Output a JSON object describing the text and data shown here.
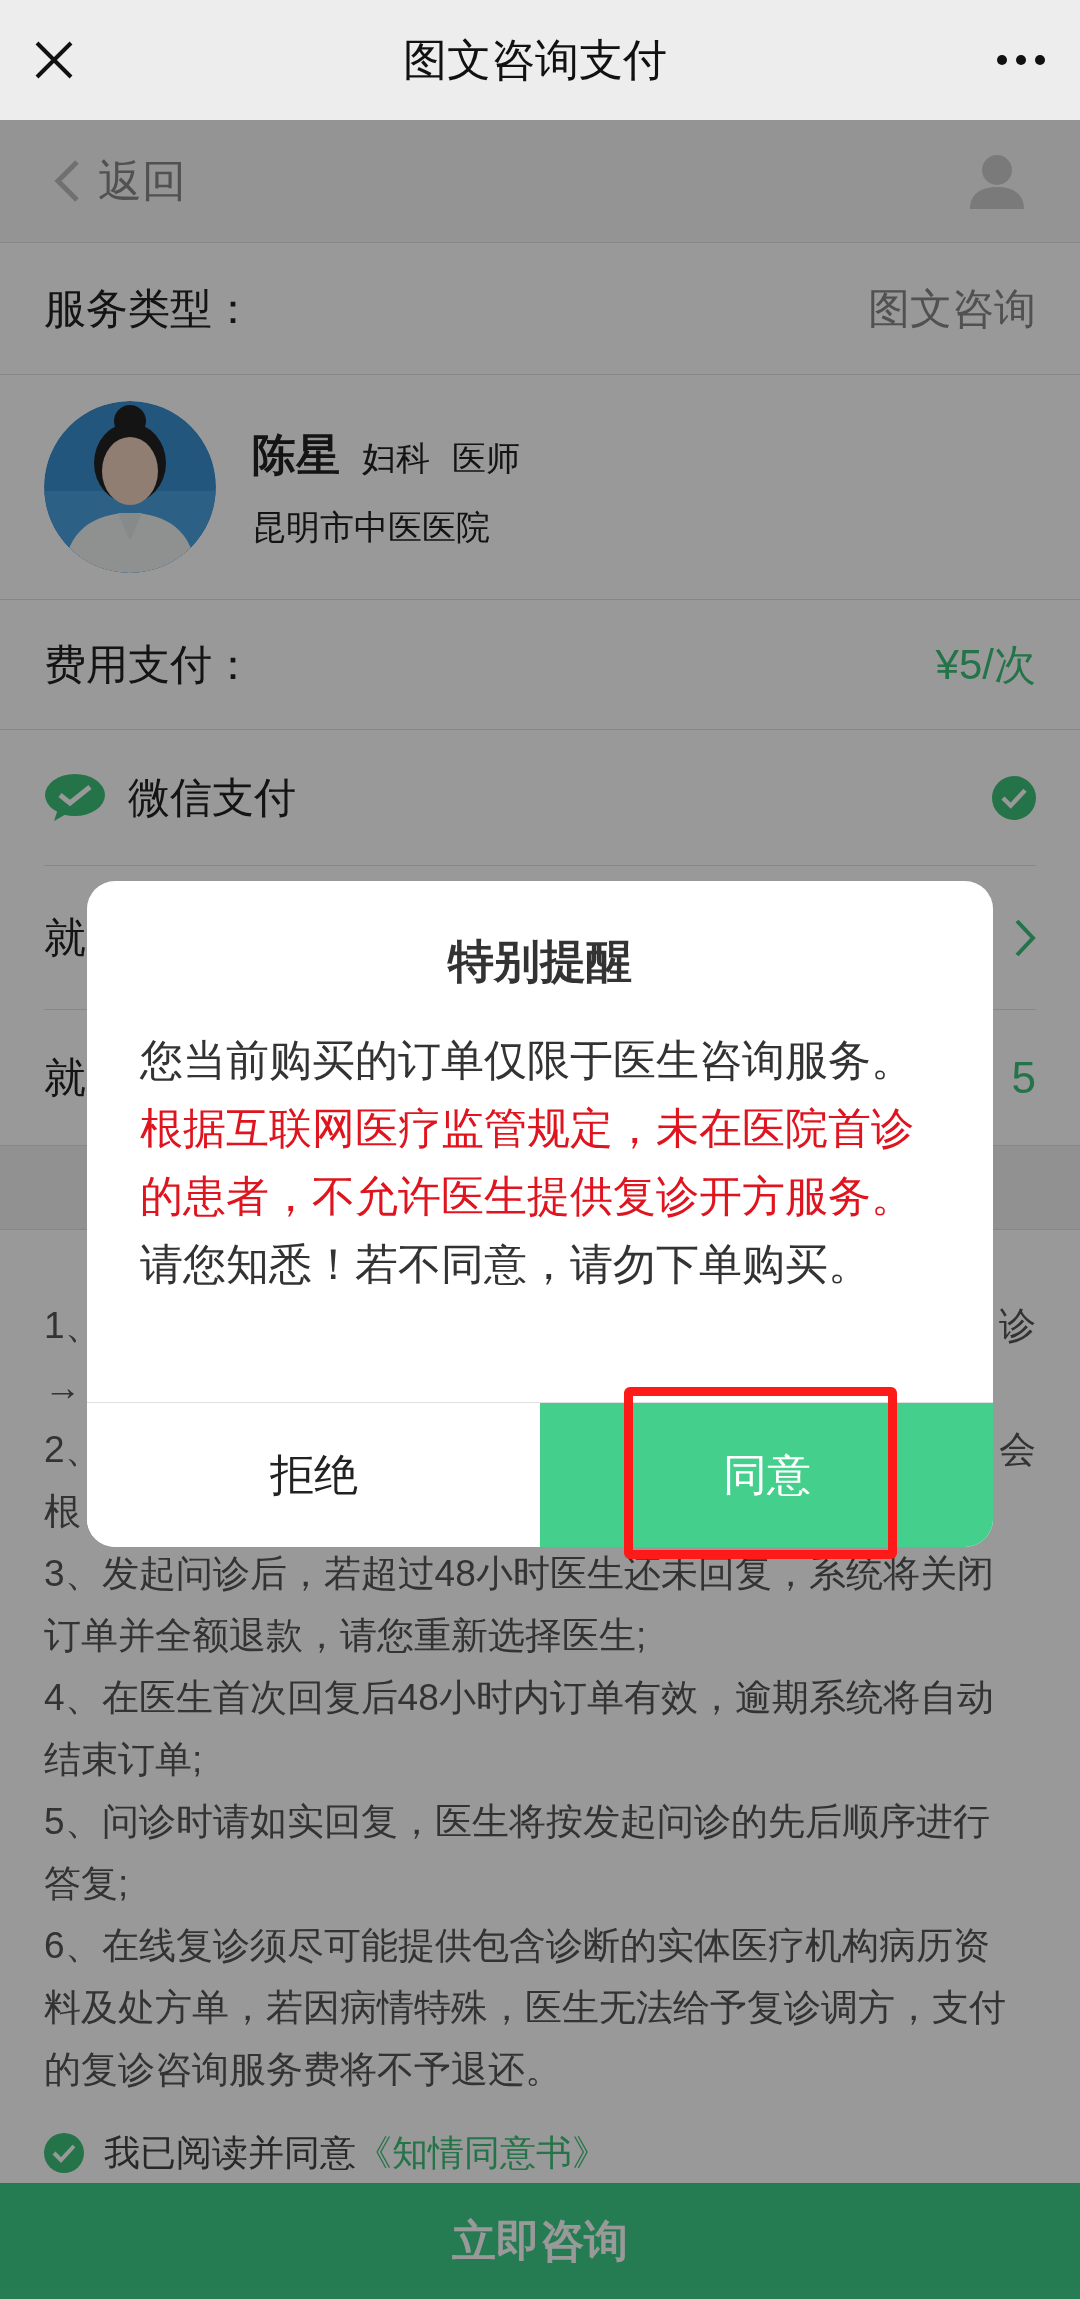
{
  "top_bar": {
    "title": "图文咨询支付"
  },
  "header": {
    "back_label": "返回"
  },
  "service": {
    "label": "服务类型：",
    "value": "图文咨询"
  },
  "doctor": {
    "name": "陈星",
    "department": "妇科",
    "title": "医师",
    "hospital": "昆明市中医医院"
  },
  "fee": {
    "label": "费用支付：",
    "value": "¥5/次"
  },
  "payment_methods": [
    {
      "label": "微信支付",
      "selected": true
    }
  ],
  "rows": [
    {
      "kind": "link",
      "label": "就"
    },
    {
      "kind": "value",
      "label": "就",
      "value": "5"
    }
  ],
  "notes": [
    {
      "lines": [
        {
          "start": "1、",
          "end": "诊"
        },
        {
          "start": "→"
        }
      ]
    },
    {
      "lines": [
        {
          "start": "2、",
          "end": "会"
        },
        {
          "start": "根"
        }
      ]
    },
    {
      "lines": [
        {
          "start": "3、发起问诊后，若超过48小时医生还未回复，系统将关闭"
        },
        {
          "start": "订单并全额退款，请您重新选择医生;"
        }
      ]
    },
    {
      "lines": [
        {
          "start": "4、在医生首次回复后48小时内订单有效，逾期系统将自动"
        },
        {
          "start": "结束订单;"
        }
      ]
    },
    {
      "lines": [
        {
          "start": "5、问诊时请如实回复，医生将按发起问诊的先后顺序进行"
        },
        {
          "start": "答复;"
        }
      ]
    },
    {
      "lines": [
        {
          "start": "6、在线复诊须尽可能提供包含诊断的实体医疗机构病历资"
        },
        {
          "start": "料及处方单，若因病情特殊，医生无法给予复诊调方，支付"
        },
        {
          "start": "的复诊咨询服务费将不予退还。"
        }
      ]
    }
  ],
  "agreement": {
    "checked": true,
    "text": "我已阅读并同意",
    "link": "《知情同意书》"
  },
  "submit_button": "立即咨询",
  "dialog": {
    "title": "特别提醒",
    "paragraphs": [
      {
        "kind": "normal",
        "text": "您当前购买的订单仅限于医生咨询服务。"
      },
      {
        "kind": "warning",
        "text": "根据互联网医疗监管规定，未在医院首诊的患者，不允许医生提供复诊开方服务。"
      },
      {
        "kind": "normal",
        "text": "请您知悉！若不同意，请勿下单购买。"
      }
    ],
    "buttons": [
      {
        "kind": "secondary",
        "label": "拒绝",
        "highlighted": false
      },
      {
        "kind": "primary",
        "label": "同意",
        "highlighted": true
      }
    ]
  }
}
